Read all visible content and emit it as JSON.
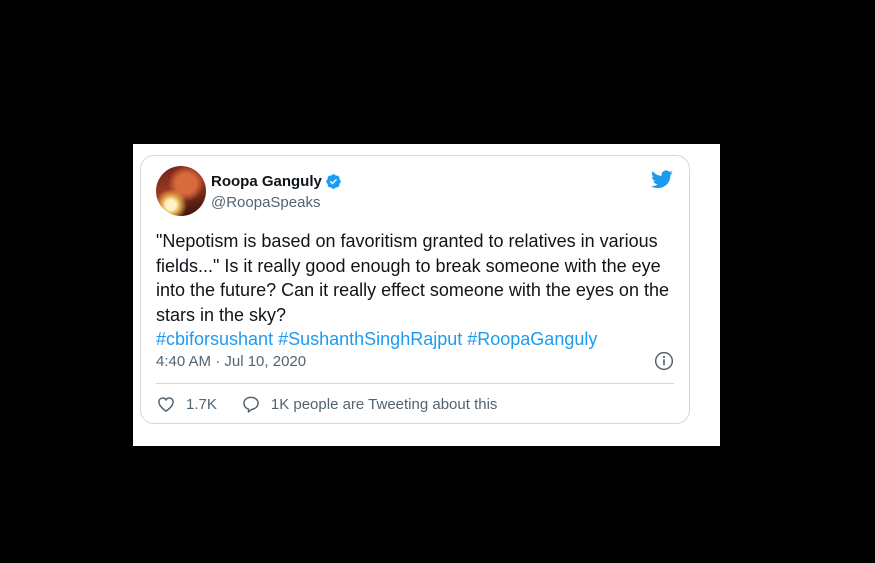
{
  "tweet": {
    "author_name": "Roopa Ganguly",
    "author_handle": "@RoopaSpeaks",
    "text": "\"Nepotism is based on favoritism granted to relatives in various fields...\" Is it really good enough to break someone with the eye into the future? Can it really effect someone with the eyes on the stars in the sky?",
    "hashtags": [
      "#cbiforsushant",
      "#SushanthSinghRajput",
      "#RoopaGanguly"
    ],
    "timestamp": "4:40 AM · Jul 10, 2020",
    "likes": "1.7K",
    "tweeting_about": "1K people are Tweeting about this"
  },
  "colors": {
    "accent": "#1d9bf0",
    "text": "#0f1419",
    "muted": "#536471",
    "border": "#cfd9de"
  },
  "icons": [
    "verified-badge-icon",
    "twitter-bird-icon",
    "info-icon",
    "heart-icon",
    "comment-icon"
  ]
}
